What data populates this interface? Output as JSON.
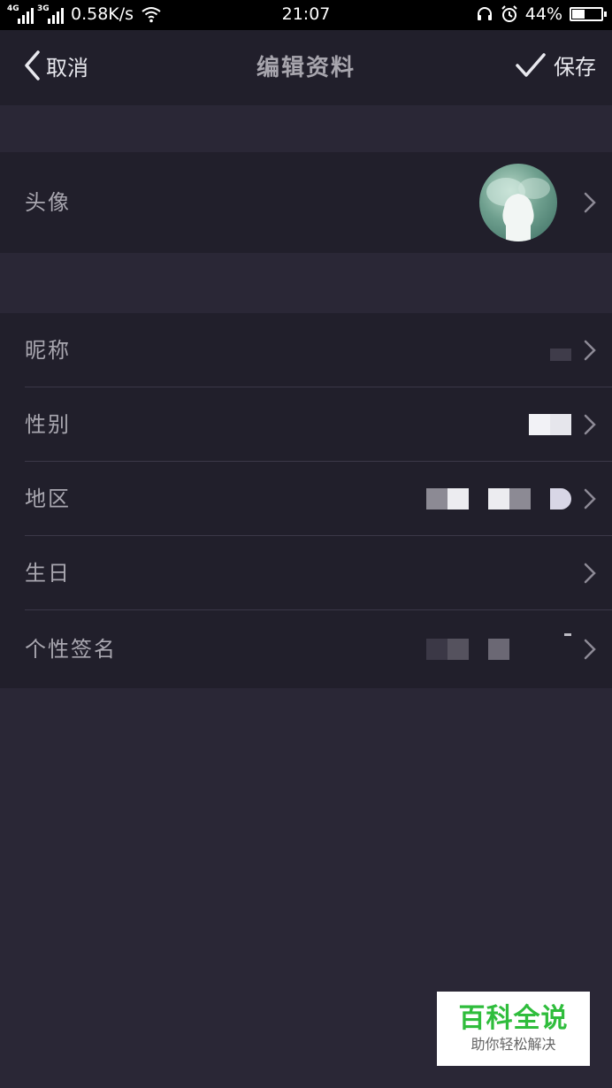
{
  "status_bar": {
    "network_1": "4G",
    "network_2": "3G",
    "speed": "0.58K/s",
    "time": "21:07",
    "battery": "44%",
    "battery_level": 0.44,
    "icons": [
      "signal-icon",
      "wifi-icon",
      "headset-icon",
      "alarm-icon",
      "battery-icon"
    ]
  },
  "nav": {
    "cancel_label": "取消",
    "title": "编辑资料",
    "save_label": "保存"
  },
  "profile": {
    "avatar_label": "头像",
    "rows": [
      {
        "label": "昵称"
      },
      {
        "label": "性别"
      },
      {
        "label": "地区"
      },
      {
        "label": "生日"
      },
      {
        "label": "个性签名"
      }
    ]
  },
  "watermark": {
    "title": "百科全说",
    "subtitle": "助你轻松解决"
  },
  "colors": {
    "background": "#2a2736",
    "panel": "#211f2b",
    "label": "#a9a7b0",
    "watermark_green": "#2fbd3c"
  }
}
